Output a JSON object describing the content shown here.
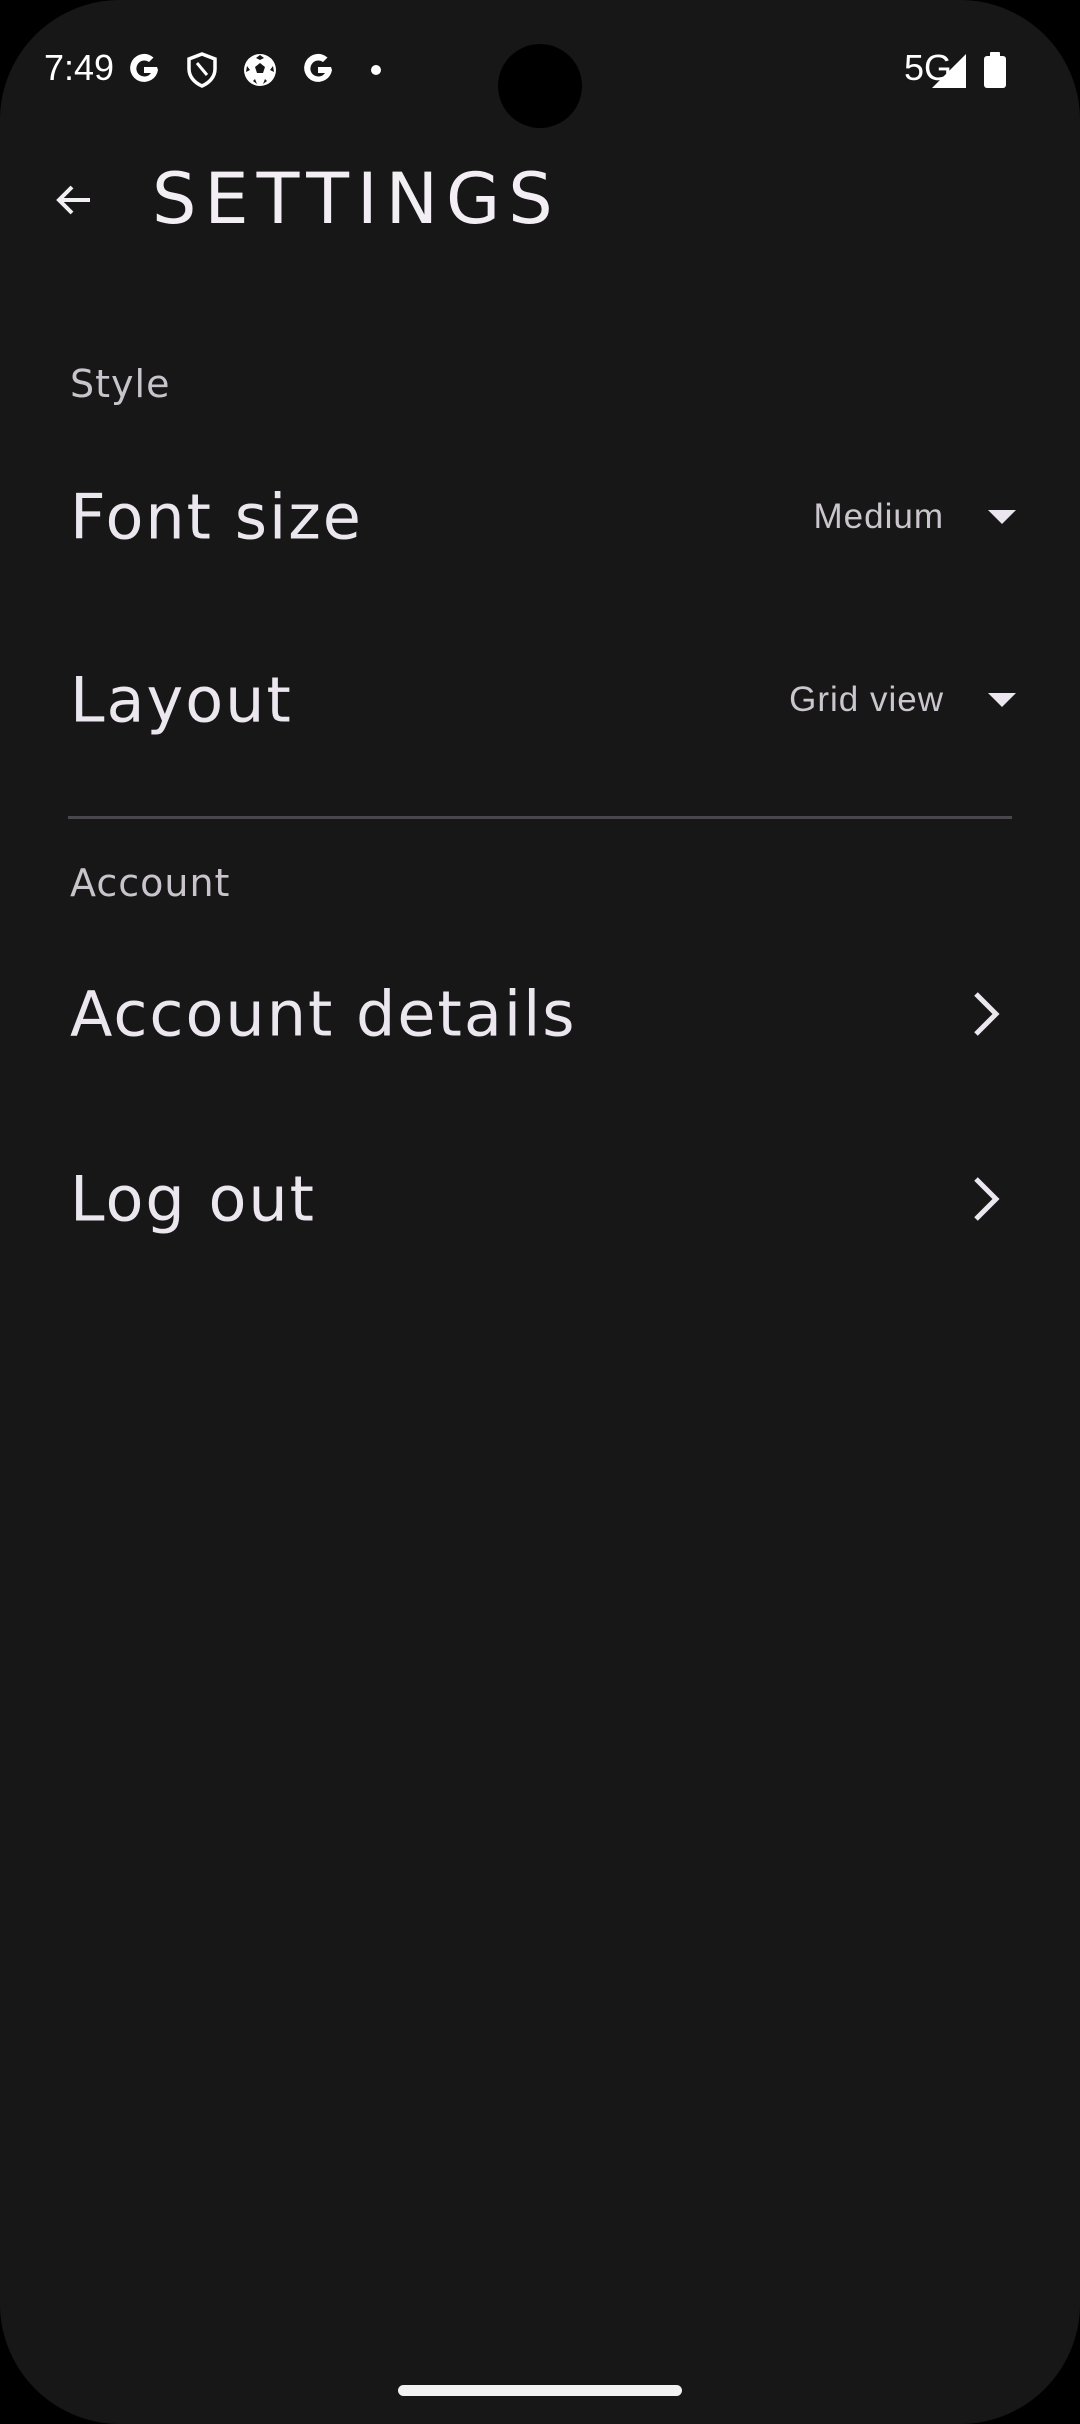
{
  "status_bar": {
    "time": "7:49",
    "network": "5G",
    "icons": [
      "google-g-icon",
      "shield-icon",
      "soccer-ball-icon",
      "google-g-icon",
      "notification-dot-icon",
      "signal-icon",
      "battery-icon"
    ]
  },
  "app_bar": {
    "back_icon": "arrow-back-icon",
    "title": "SETTINGS"
  },
  "sections": {
    "style": {
      "header": "Style",
      "font_size": {
        "label": "Font size",
        "value": "Medium",
        "icon": "dropdown-arrow-icon"
      },
      "layout": {
        "label": "Layout",
        "value": "Grid view",
        "icon": "dropdown-arrow-icon"
      }
    },
    "account": {
      "header": "Account",
      "account_details": {
        "label": "Account details",
        "icon": "chevron-right-icon"
      },
      "log_out": {
        "label": "Log out",
        "icon": "chevron-right-icon"
      }
    }
  },
  "colors": {
    "background": "#171717",
    "text_primary": "#ece7ef",
    "text_secondary": "#c9c4cc",
    "divider": "#4a474c"
  }
}
